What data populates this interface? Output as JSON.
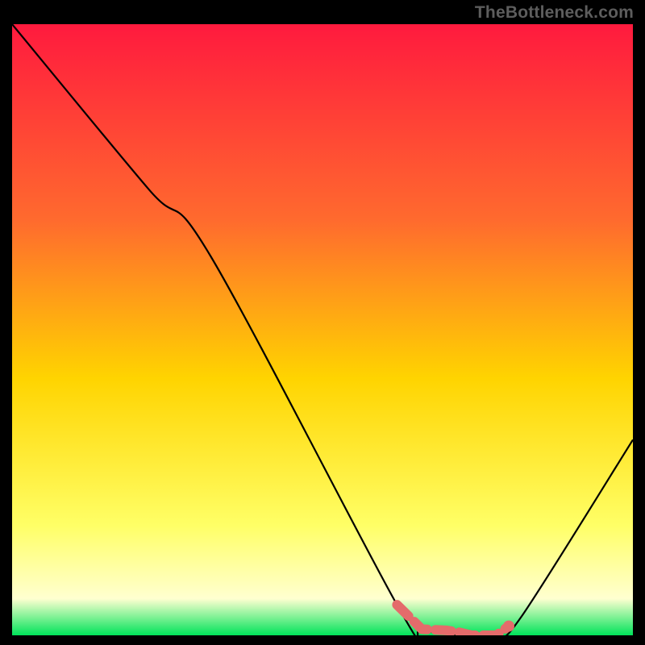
{
  "watermark": "TheBottleneck.com",
  "colors": {
    "gradient_top": "#ff1a3e",
    "gradient_mid_upper": "#ff6a2e",
    "gradient_mid": "#ffd400",
    "gradient_mid_lower": "#ffff66",
    "gradient_near_bottom": "#ffffd0",
    "gradient_bottom": "#00e35a",
    "curve": "#000000",
    "marker": "#e46b6b",
    "frame_bg": "#000000"
  },
  "chart_data": {
    "type": "line",
    "title": "",
    "xlabel": "",
    "ylabel": "",
    "xlim": [
      0,
      100
    ],
    "ylim": [
      0,
      100
    ],
    "series": [
      {
        "name": "bottleneck-curve",
        "x": [
          0,
          22,
          32,
          62,
          66,
          74,
          78,
          82,
          100
        ],
        "y": [
          100,
          73,
          62,
          5,
          1,
          0,
          0,
          3,
          32
        ]
      }
    ],
    "markers": {
      "name": "highlight-segment",
      "points": [
        {
          "x": 62,
          "y": 5
        },
        {
          "x": 66,
          "y": 1
        },
        {
          "x": 70,
          "y": 0.8
        },
        {
          "x": 72,
          "y": 0.5
        },
        {
          "x": 74,
          "y": 0
        },
        {
          "x": 76,
          "y": 0
        },
        {
          "x": 78,
          "y": 0
        },
        {
          "x": 80,
          "y": 1.5
        }
      ],
      "dot": {
        "x": 80,
        "y": 1.5
      }
    }
  }
}
